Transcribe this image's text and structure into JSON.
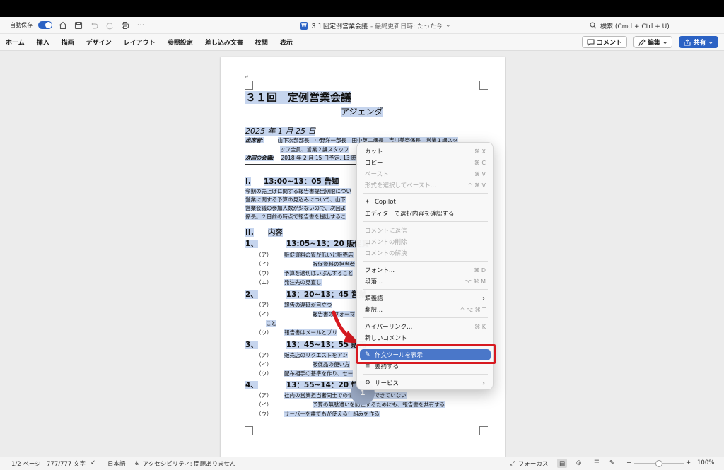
{
  "titlebar": {
    "autosave_label": "自動保存",
    "doc_title": "３１回定例営業会議",
    "doc_status": "- 最終更新日時: たった今",
    "search_placeholder": "検索 (Cmd + Ctrl + U)"
  },
  "ribbon": {
    "tabs": [
      "ホーム",
      "挿入",
      "描画",
      "デザイン",
      "レイアウト",
      "参照設定",
      "差し込み文書",
      "校閲",
      "表示"
    ],
    "comment_label": "コメント",
    "edit_label": "編集",
    "share_label": "共有"
  },
  "document": {
    "title": "３１回　定例営業会議",
    "subtitle": "アジェンダ",
    "date": "2025 年 1 月 25 日",
    "attendees_label": "出席者:",
    "attendees_1": "山下次部部長　中野洋一部長　田中英二課長　吉川美奈係長　営業１課スタ",
    "attendees_2": "ッフ全員、営業２課スタッフ",
    "next_label": "次回の会議:",
    "next_value": "2018 年 2 月 15 日予定, 13 時",
    "sec1_num": "I.",
    "sec1_title": "13:00~13：05 告知",
    "sec1_body_1": "今期の売上げに関する報告書提出期限につい",
    "sec1_body_2": "営業に関する予算の見込みについて、山下",
    "sec1_body_3": "営業会議の参加人数が少ないので、次回よ",
    "sec1_body_4": "係長。２日前の時点で報告書を提出するこ",
    "sec2_num": "II.",
    "sec2_title": "内容",
    "s1_num": "1、",
    "s1_title": "13:05~13：20 販促資",
    "s1_a": "販促資料の質が低いと販売店",
    "s1_b": "販促資料の担当者",
    "s1_c": "予算を適切はいぶんすること",
    "s1_d": "発注先の見直し",
    "s2_num": "2、",
    "s2_title": "13：20~13：45 営業",
    "s2_a": "報告の遅延が目立つ",
    "s2_b": "報告書のフォーマ",
    "s2_b2": "こと",
    "s2_c": "報告書はメールとプリ",
    "s3_num": "3、",
    "s3_title": "13：45~13：55 販売",
    "s3_a": "販売店のリクエストをアン",
    "s3_b": "販促品の使い方",
    "s3_c": "配布相手の基準を作り、セー",
    "s4_num": "4、",
    "s4_title": "13：55~14：20 情報",
    "s4_a": "社内の営業担当者同士での情報共有ができていない",
    "s4_b": "予算の無駄遣いを防止するためにも、報告書を共有する",
    "s4_c": "サーバーを誰でもが使える仕組みを作る",
    "marks": [
      "（ア）",
      "（イ）",
      "（ウ）",
      "（エ）"
    ],
    "page_badge": "1"
  },
  "context_menu": {
    "cut": "カット",
    "cut_sc": "⌘ X",
    "copy": "コピー",
    "copy_sc": "⌘ C",
    "paste": "ペースト",
    "paste_sc": "⌘ V",
    "paste_fmt": "形式を選択してペースト...",
    "paste_fmt_sc": "^ ⌘ V",
    "copilot": "Copilot",
    "editor_check": "エディターで選択内容を確認する",
    "reply_comment": "コメントに返信",
    "delete_comment": "コメントの削除",
    "resolve_comment": "コメントの解決",
    "font": "フォント...",
    "font_sc": "⌘ D",
    "paragraph": "段落...",
    "paragraph_sc": "⌥ ⌘ M",
    "synonyms": "類義語",
    "translate": "翻訳...",
    "translate_sc": "^ ⌥ ⌘ T",
    "hyperlink": "ハイパーリンク...",
    "hyperlink_sc": "⌘ K",
    "new_comment": "新しいコメント",
    "writing_tools": "作文ツールを表示",
    "summarize": "要約する",
    "services": "サービス"
  },
  "statusbar": {
    "page": "1/2 ページ",
    "words": "777/777 文字",
    "language": "日本語",
    "accessibility": "アクセシビリティ: 問題ありません",
    "focus": "フォーカス",
    "zoom": "100%",
    "zoom_minus": "−",
    "zoom_plus": "+"
  },
  "colors": {
    "accent": "#2b62c4",
    "selection": "#c6d5ee",
    "menu_highlight": "#4a77c9",
    "annotation_red": "#d71920"
  }
}
